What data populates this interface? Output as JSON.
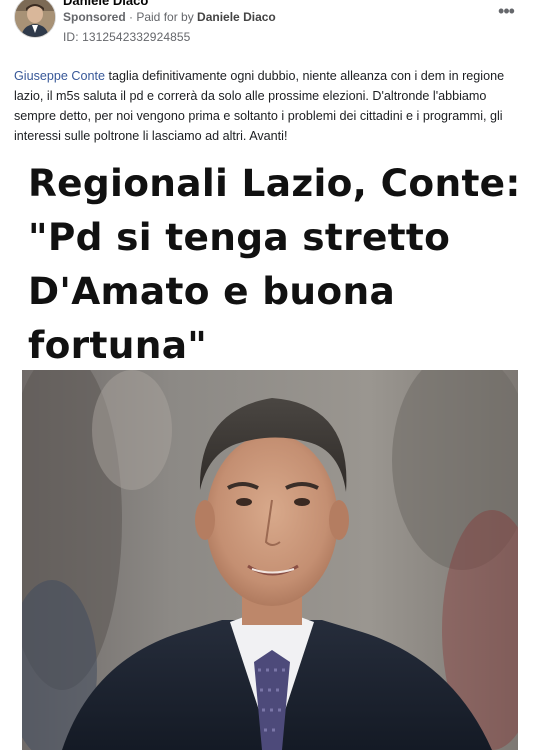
{
  "post": {
    "author": "Daniele Diaco",
    "sponsored_label": "Sponsored",
    "paid_for_prefix": " · Paid for by ",
    "paid_for_name": "Daniele Diaco",
    "ad_id": "ID: 1312542332924855",
    "more_icon": "more-options-icon",
    "more_glyph": "•••",
    "caption": {
      "mention": "Giuseppe Conte",
      "text": " taglia definitivamente ogni dubbio, niente alleanza con i dem in regione lazio, il m5s saluta il pd e correrà da solo alle prossime elezioni. D'altronde l'abbiamo sempre detto, per noi vengono prima e soltanto i problemi dei cittadini e i programmi, gli interessi sulle poltrone li lasciamo ad altri. Avanti!"
    },
    "image": {
      "headline_lines": [
        "Regionali Lazio, Conte:",
        "\"Pd si tenga stretto",
        "D'Amato e buona",
        "fortuna\""
      ]
    }
  }
}
